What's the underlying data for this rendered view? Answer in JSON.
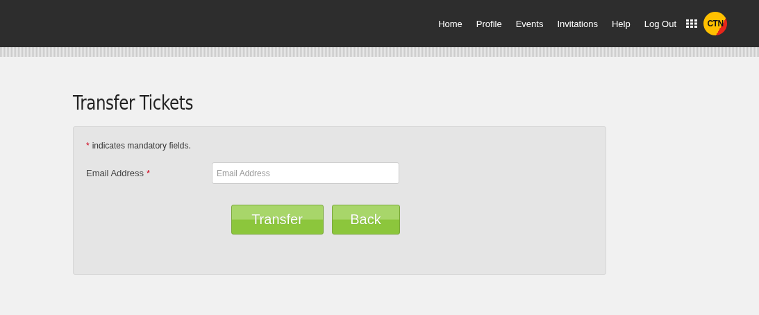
{
  "nav": [
    {
      "label": "Home"
    },
    {
      "label": "Profile"
    },
    {
      "label": "Events"
    },
    {
      "label": "Invitations"
    },
    {
      "label": "Help"
    },
    {
      "label": "Log Out"
    }
  ],
  "logo": {
    "text": "CTN"
  },
  "title": "Transfer Tickets",
  "note": {
    "mark": "*",
    "text": "indicates mandatory fields."
  },
  "fields": [
    {
      "label": "Email Address",
      "required": true,
      "placeholder": "Email Address"
    }
  ],
  "buttons": [
    "Transfer",
    "Back"
  ]
}
